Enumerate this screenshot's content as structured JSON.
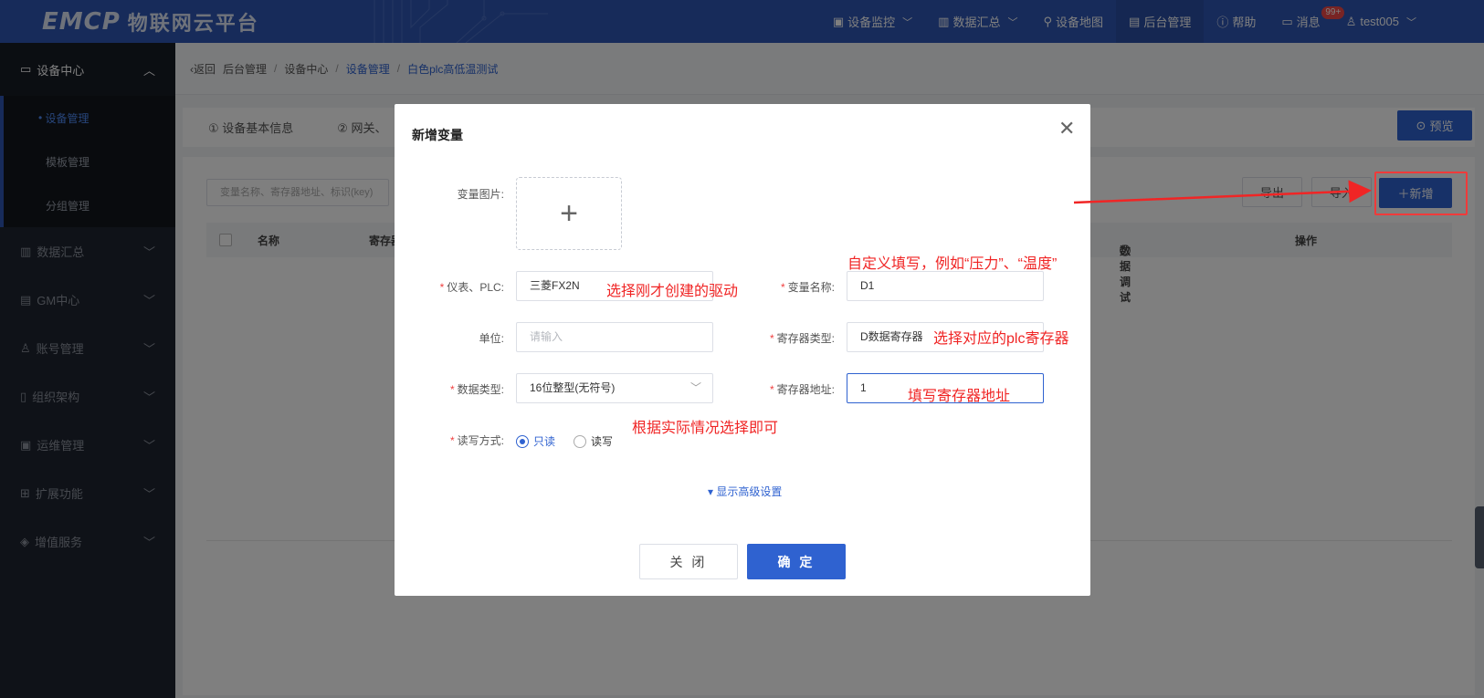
{
  "app": {
    "logo_mark": "EMCP",
    "logo_text": "物联网云平台"
  },
  "nav": {
    "items": [
      {
        "label": "设备监控",
        "icon": "monitor-icon",
        "dropdown": true
      },
      {
        "label": "数据汇总",
        "icon": "bar-chart-icon",
        "dropdown": true
      },
      {
        "label": "设备地图",
        "icon": "map-pin-icon",
        "dropdown": false
      },
      {
        "label": "后台管理",
        "icon": "dashboard-icon",
        "dropdown": false,
        "active": true
      },
      {
        "label": "帮助",
        "icon": "help-icon",
        "dropdown": false
      },
      {
        "label": "消息",
        "icon": "message-icon",
        "dropdown": false,
        "badge": "99+"
      },
      {
        "label": "test005",
        "icon": "user-icon",
        "dropdown": true
      }
    ]
  },
  "sidebar": {
    "header": "设备中心",
    "sub_items": [
      "设备管理",
      "模板管理",
      "分组管理"
    ],
    "items": [
      "数据汇总",
      "GM中心",
      "账号管理",
      "组织架构",
      "运维管理",
      "扩展功能",
      "增值服务"
    ]
  },
  "breadcrumb": {
    "back": "返回",
    "items": [
      "后台管理",
      "设备中心",
      "设备管理",
      "白色plc高低温测试"
    ]
  },
  "tabs": [
    "① 设备基本信息",
    "② 网关、"
  ],
  "preview_button": "预览",
  "toolbar": {
    "search_placeholder": "变量名称、寄存器地址、标识(key)",
    "export": "导出",
    "import": "导入",
    "add": "新增"
  },
  "table": {
    "headers": [
      "名称",
      "寄存器",
      "数据调试",
      "操作"
    ]
  },
  "modal": {
    "title": "新增变量",
    "labels": {
      "image": "变量图片:",
      "plc": "仪表、PLC:",
      "var_name": "变量名称:",
      "unit": "单位:",
      "register_type": "寄存器类型:",
      "data_type": "数据类型:",
      "register_addr": "寄存器地址:",
      "rw_mode": "读写方式:"
    },
    "values": {
      "plc": "三菱FX2N",
      "var_name": "D1",
      "unit_placeholder": "请输入",
      "register_type": "D数据寄存器",
      "data_type": "16位整型(无符号)",
      "register_addr": "1"
    },
    "radio": {
      "read_only": "只读",
      "read_write": "读写",
      "selected": "只读"
    },
    "advanced": "显示高级设置",
    "close_button": "关 闭",
    "ok_button": "确 定"
  },
  "annotations": {
    "plc": "选择刚才创建的驱动",
    "var_name": "自定义填写，例如“压力”、“温度”",
    "register_type": "选择对应的plc寄存器",
    "register_addr": "填写寄存器地址",
    "rw_mode": "根据实际情况选择即可"
  },
  "colors": {
    "primary": "#2f62d0",
    "topbar": "#2f57b5",
    "sidebar": "#1f2530",
    "annotation": "#f02525"
  }
}
